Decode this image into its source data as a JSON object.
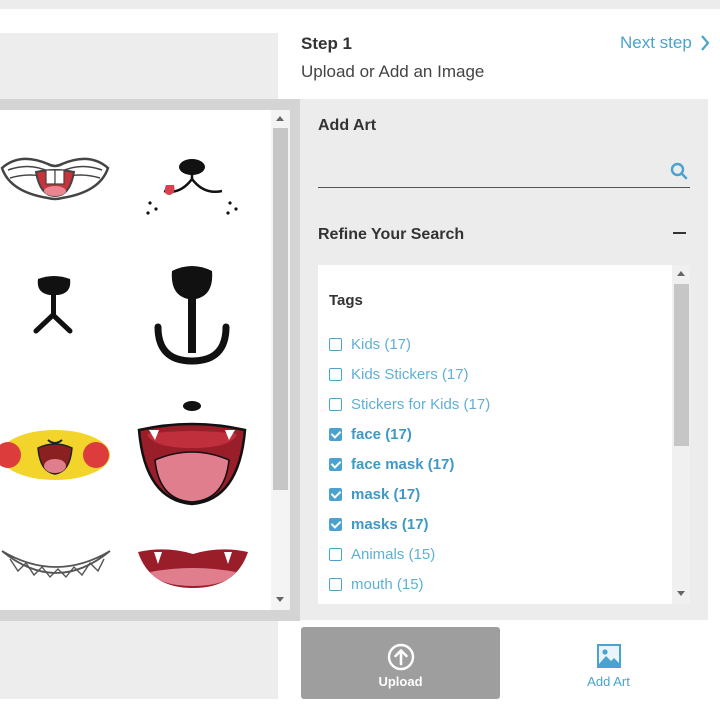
{
  "header": {
    "step_title": "Step 1",
    "step_subtitle": "Upload or Add an Image",
    "next_step_label": "Next step"
  },
  "gallery": {
    "items": [
      "bunny-mouth-icon",
      "cat-nose-icon",
      "small-dog-nose-icon",
      "dog-nose-anchor-icon",
      "pikachu-mouth-icon",
      "open-mouth-tongue-icon",
      "shark-teeth-icon",
      "fang-mouth-icon"
    ]
  },
  "panel": {
    "add_art_label": "Add Art",
    "search_placeholder": "",
    "refine_label": "Refine Your Search",
    "tags_title": "Tags",
    "tags": [
      {
        "label": "Kids (17)",
        "checked": false
      },
      {
        "label": "Kids Stickers (17)",
        "checked": false
      },
      {
        "label": "Stickers for Kids (17)",
        "checked": false
      },
      {
        "label": "face (17)",
        "checked": true
      },
      {
        "label": "face mask (17)",
        "checked": true
      },
      {
        "label": "mask (17)",
        "checked": true
      },
      {
        "label": "masks (17)",
        "checked": true
      },
      {
        "label": "Animals (15)",
        "checked": false
      },
      {
        "label": "mouth (15)",
        "checked": false
      }
    ]
  },
  "actions": {
    "upload_label": "Upload",
    "add_art_label": "Add Art"
  },
  "colors": {
    "accent": "#4aa3cf",
    "upload_bg": "#9e9e9e",
    "panel_bg": "#ececec"
  }
}
